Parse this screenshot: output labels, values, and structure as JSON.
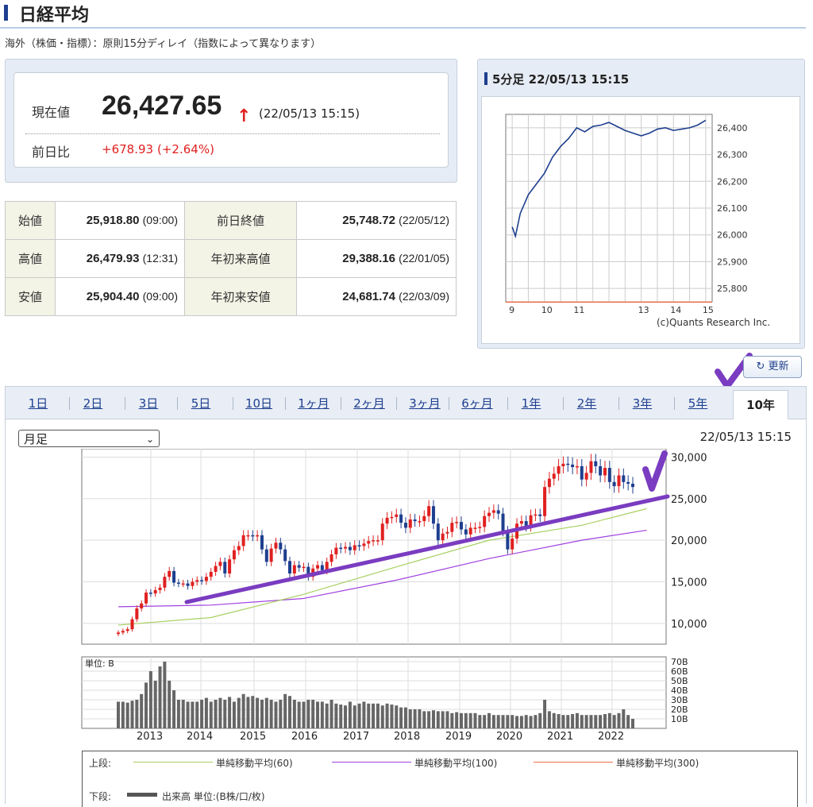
{
  "page": {
    "title": "日経平均",
    "note": "海外（株価・指標）：原則15分ディレイ（指数によって異なります）"
  },
  "quote": {
    "price_label": "現在値",
    "price": "26,427.65",
    "arrow": "↑",
    "time": "(22/05/13 15:15)",
    "change_label": "前日比",
    "change": "+678.93",
    "change_pct": "(+2.64%)"
  },
  "stats": {
    "open_label": "始値",
    "open": "25,918.80",
    "open_time": "(09:00)",
    "high_label": "高値",
    "high": "26,479.93",
    "high_time": "(12:31)",
    "low_label": "安値",
    "low": "25,904.40",
    "low_time": "(09:00)",
    "prev_label": "前日終値",
    "prev": "25,748.72",
    "prev_date": "(22/05/12)",
    "ytd_high_label": "年初来高値",
    "ytd_high": "29,388.16",
    "ytd_high_date": "(22/01/05)",
    "ytd_low_label": "年初来安値",
    "ytd_low": "24,681.74",
    "ytd_low_date": "(22/03/09)"
  },
  "mini_chart_header": "5分足 22/05/13 15:15",
  "refresh_label": "更新",
  "refresh_icon": "refresh-icon",
  "tabs": [
    {
      "label": "1日"
    },
    {
      "label": "2日"
    },
    {
      "label": "3日"
    },
    {
      "label": "5日"
    },
    {
      "label": "10日"
    },
    {
      "label": "1ヶ月"
    },
    {
      "label": "2ヶ月"
    },
    {
      "label": "3ヶ月"
    },
    {
      "label": "6ヶ月"
    },
    {
      "label": "1年"
    },
    {
      "label": "2年"
    },
    {
      "label": "3年"
    },
    {
      "label": "5年"
    },
    {
      "label": "10年"
    }
  ],
  "active_tab": "10年",
  "period_select": "月足",
  "main_timestamp": "22/05/13 15:15",
  "legend": {
    "upper_label": "上段:",
    "ma60": "単純移動平均(60)",
    "ma100": "単純移動平均(100)",
    "ma300": "単純移動平均(300)",
    "lower_label": "下段:",
    "volume": "出来高 単位:(B株/口/枚)"
  },
  "colors": {
    "up": "#e02020",
    "down": "#1e3f8f",
    "ma60": "#a8d060",
    "ma100": "#a040e0",
    "ma300": "#f07050",
    "annotation": "#7a3cc0"
  },
  "chart_data": [
    {
      "type": "line",
      "title": "5分足 22/05/13 15:15",
      "x": [
        9.0,
        9.1,
        9.25,
        9.5,
        9.75,
        10.0,
        10.25,
        10.5,
        10.75,
        11.0,
        11.25,
        11.5,
        11.75,
        12.0,
        12.5,
        13.0,
        13.25,
        13.5,
        13.75,
        14.0,
        14.25,
        14.5,
        14.75,
        15.0
      ],
      "values": [
        26030,
        25995,
        26080,
        26150,
        26190,
        26230,
        26290,
        26330,
        26360,
        26400,
        26385,
        26405,
        26410,
        26420,
        26390,
        26370,
        26380,
        26395,
        26400,
        26390,
        26395,
        26400,
        26410,
        26428
      ],
      "x_ticks": [
        "9",
        "10",
        "11",
        "13",
        "14",
        "15"
      ],
      "y_ticks": [
        "26,400",
        "26,300",
        "26,200",
        "26,100",
        "26,000",
        "25,900",
        "25,800"
      ],
      "ylim": [
        25750,
        26450
      ],
      "reference_line": 25748.72,
      "annotation": "(c)Quants Research Inc."
    },
    {
      "type": "candlestick",
      "series_name": "月足",
      "x_labels": [
        "2013",
        "2014",
        "2015",
        "2016",
        "2017",
        "2018",
        "2019",
        "2020",
        "2021",
        "2022"
      ],
      "y_ticks": [
        "30,000",
        "25,000",
        "20,000",
        "15,000",
        "10,000"
      ],
      "ylim": [
        7500,
        31000
      ],
      "monthly_close": [
        8900,
        9100,
        9300,
        10500,
        11800,
        12400,
        13700,
        13600,
        14000,
        14300,
        15600,
        16300,
        14900,
        14800,
        14800,
        14500,
        15000,
        15200,
        15100,
        15600,
        16200,
        16900,
        17400,
        16000,
        17700,
        18800,
        19300,
        20600,
        20600,
        20500,
        20600,
        18900,
        17400,
        19000,
        19700,
        18900,
        17500,
        16000,
        17000,
        16700,
        16800,
        15600,
        16600,
        17000,
        16400,
        17400,
        18300,
        19100,
        19000,
        19200,
        18800,
        19400,
        19300,
        19600,
        19900,
        20000,
        20000,
        22000,
        22700,
        22800,
        23100,
        22100,
        21500,
        22500,
        22300,
        22300,
        22900,
        24100,
        22000,
        20000,
        20800,
        21000,
        22100,
        22200,
        21300,
        20700,
        21500,
        21500,
        21600,
        22900,
        23300,
        23600,
        23200,
        21100,
        18900,
        20200,
        22000,
        22300,
        21700,
        23000,
        23100,
        22900,
        26400,
        27400,
        28000,
        28900,
        29200,
        29100,
        28800,
        28900,
        27300,
        28100,
        29500,
        28900,
        27800,
        28700,
        27000,
        26500,
        27800,
        27000,
        26800,
        26400
      ],
      "ma60_points": [
        [
          0,
          9800
        ],
        [
          20,
          10700
        ],
        [
          40,
          13500
        ],
        [
          60,
          16800
        ],
        [
          80,
          20000
        ],
        [
          100,
          21800
        ],
        [
          114,
          23800
        ]
      ],
      "ma100_points": [
        [
          0,
          12000
        ],
        [
          20,
          12200
        ],
        [
          40,
          13000
        ],
        [
          60,
          15200
        ],
        [
          80,
          17800
        ],
        [
          100,
          20000
        ],
        [
          114,
          21200
        ]
      ],
      "volume_y_ticks": [
        "70B",
        "60B",
        "50B",
        "40B",
        "30B",
        "20B",
        "10B"
      ],
      "volume_unit": "単位: B",
      "volume_values": [
        28,
        28,
        27,
        29,
        30,
        36,
        48,
        60,
        50,
        65,
        70,
        50,
        40,
        30,
        30,
        28,
        28,
        28,
        30,
        32,
        28,
        30,
        32,
        30,
        33,
        28,
        32,
        36,
        33,
        34,
        32,
        30,
        32,
        30,
        28,
        30,
        36,
        34,
        30,
        28,
        28,
        30,
        30,
        28,
        28,
        26,
        30,
        26,
        25,
        24,
        28,
        24,
        26,
        28,
        26,
        26,
        26,
        24,
        26,
        25,
        24,
        22,
        22,
        20,
        20,
        20,
        18,
        18,
        19,
        18,
        18,
        18,
        16,
        17,
        16,
        16,
        16,
        16,
        14,
        14,
        16,
        14,
        14,
        14,
        14,
        14,
        13,
        13,
        14,
        13,
        14,
        16,
        30,
        18,
        16,
        15,
        14,
        14,
        15,
        16,
        14,
        14,
        14,
        14,
        14,
        15,
        16,
        14,
        16,
        20,
        14,
        10
      ]
    }
  ]
}
